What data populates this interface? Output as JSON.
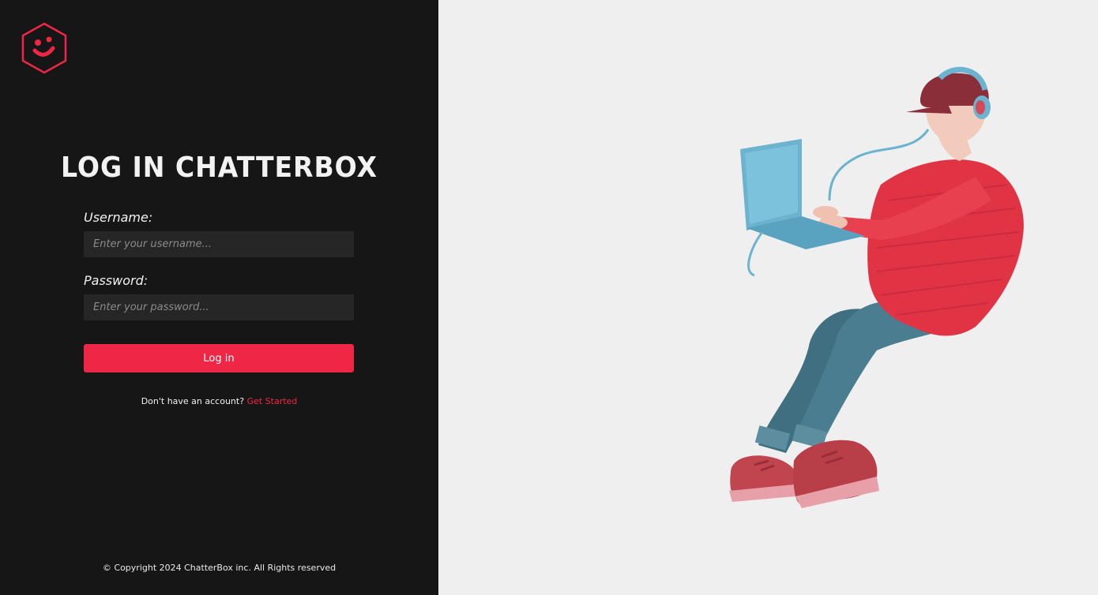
{
  "brand": {
    "logo_icon": "smiley-hexagon-icon",
    "accent_color": "#f02646",
    "panel_color": "#161616",
    "background_color": "#efefef"
  },
  "login": {
    "title": "LOG IN CHATTERBOX",
    "username_label": "Username:",
    "username_placeholder": "Enter your username...",
    "username_value": "",
    "password_label": "Password:",
    "password_placeholder": "Enter your password...",
    "password_value": "",
    "submit_label": "Log in",
    "signup_prompt": "Don't have an account?",
    "signup_link": "Get Started"
  },
  "footer": {
    "copyright": "© Copyright 2024 ChatterBox inc. All Rights reserved"
  },
  "illustration": {
    "icon": "person-with-laptop-illustration"
  }
}
